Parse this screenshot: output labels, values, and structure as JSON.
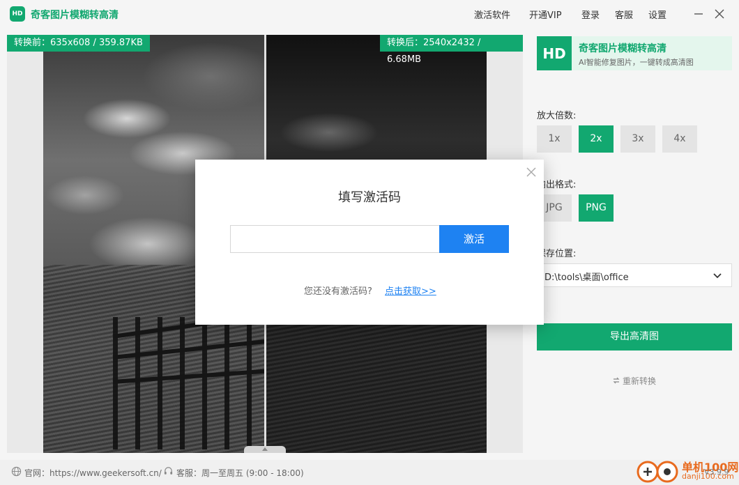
{
  "app": {
    "logo_text": "HD",
    "title": "奇客图片模糊转高清"
  },
  "topnav": {
    "activate": "激活软件",
    "vip": "开通VIP",
    "login": "登录",
    "service": "客服",
    "settings": "设置"
  },
  "preview": {
    "before_label": "转换前：635x608 / 359.87KB",
    "after_label": "转换后：2540x2432 / 6.68MB"
  },
  "panel": {
    "hd_icon": "HD",
    "hd_title": "奇客图片模糊转高清",
    "hd_subtitle": "AI智能修复图片，一键转成高清图",
    "scale_label": "放大倍数:",
    "scale_options": [
      "1x",
      "2x",
      "3x",
      "4x"
    ],
    "scale_selected": "2x",
    "format_label": "输出格式:",
    "format_options": [
      "JPG",
      "PNG"
    ],
    "format_selected": "PNG",
    "save_label": "保存位置:",
    "save_path": "D:\\tools\\桌面\\office",
    "export_button": "导出高清图",
    "reconvert": "重新转换"
  },
  "footer": {
    "website": "官网：https://www.geekersoft.cn/",
    "service_hours": "客服：周一至周五 (9:00 - 18:00)",
    "version": "V3.9.9"
  },
  "watermark": {
    "site_cn": "单机100网",
    "site_url": "danji100.com"
  },
  "modal": {
    "title": "填写激活码",
    "input_value": "",
    "activate_button": "激活",
    "no_code_text": "您还没有激活码?",
    "get_link": "点击获取>>"
  },
  "colors": {
    "brand_green": "#12a870",
    "accent_blue": "#1e82f2",
    "watermark_orange": "#e86a1e"
  },
  "icons": [
    "close-icon",
    "minimize-icon",
    "chevron-down-icon",
    "refresh-icon",
    "globe-icon",
    "headset-icon"
  ]
}
